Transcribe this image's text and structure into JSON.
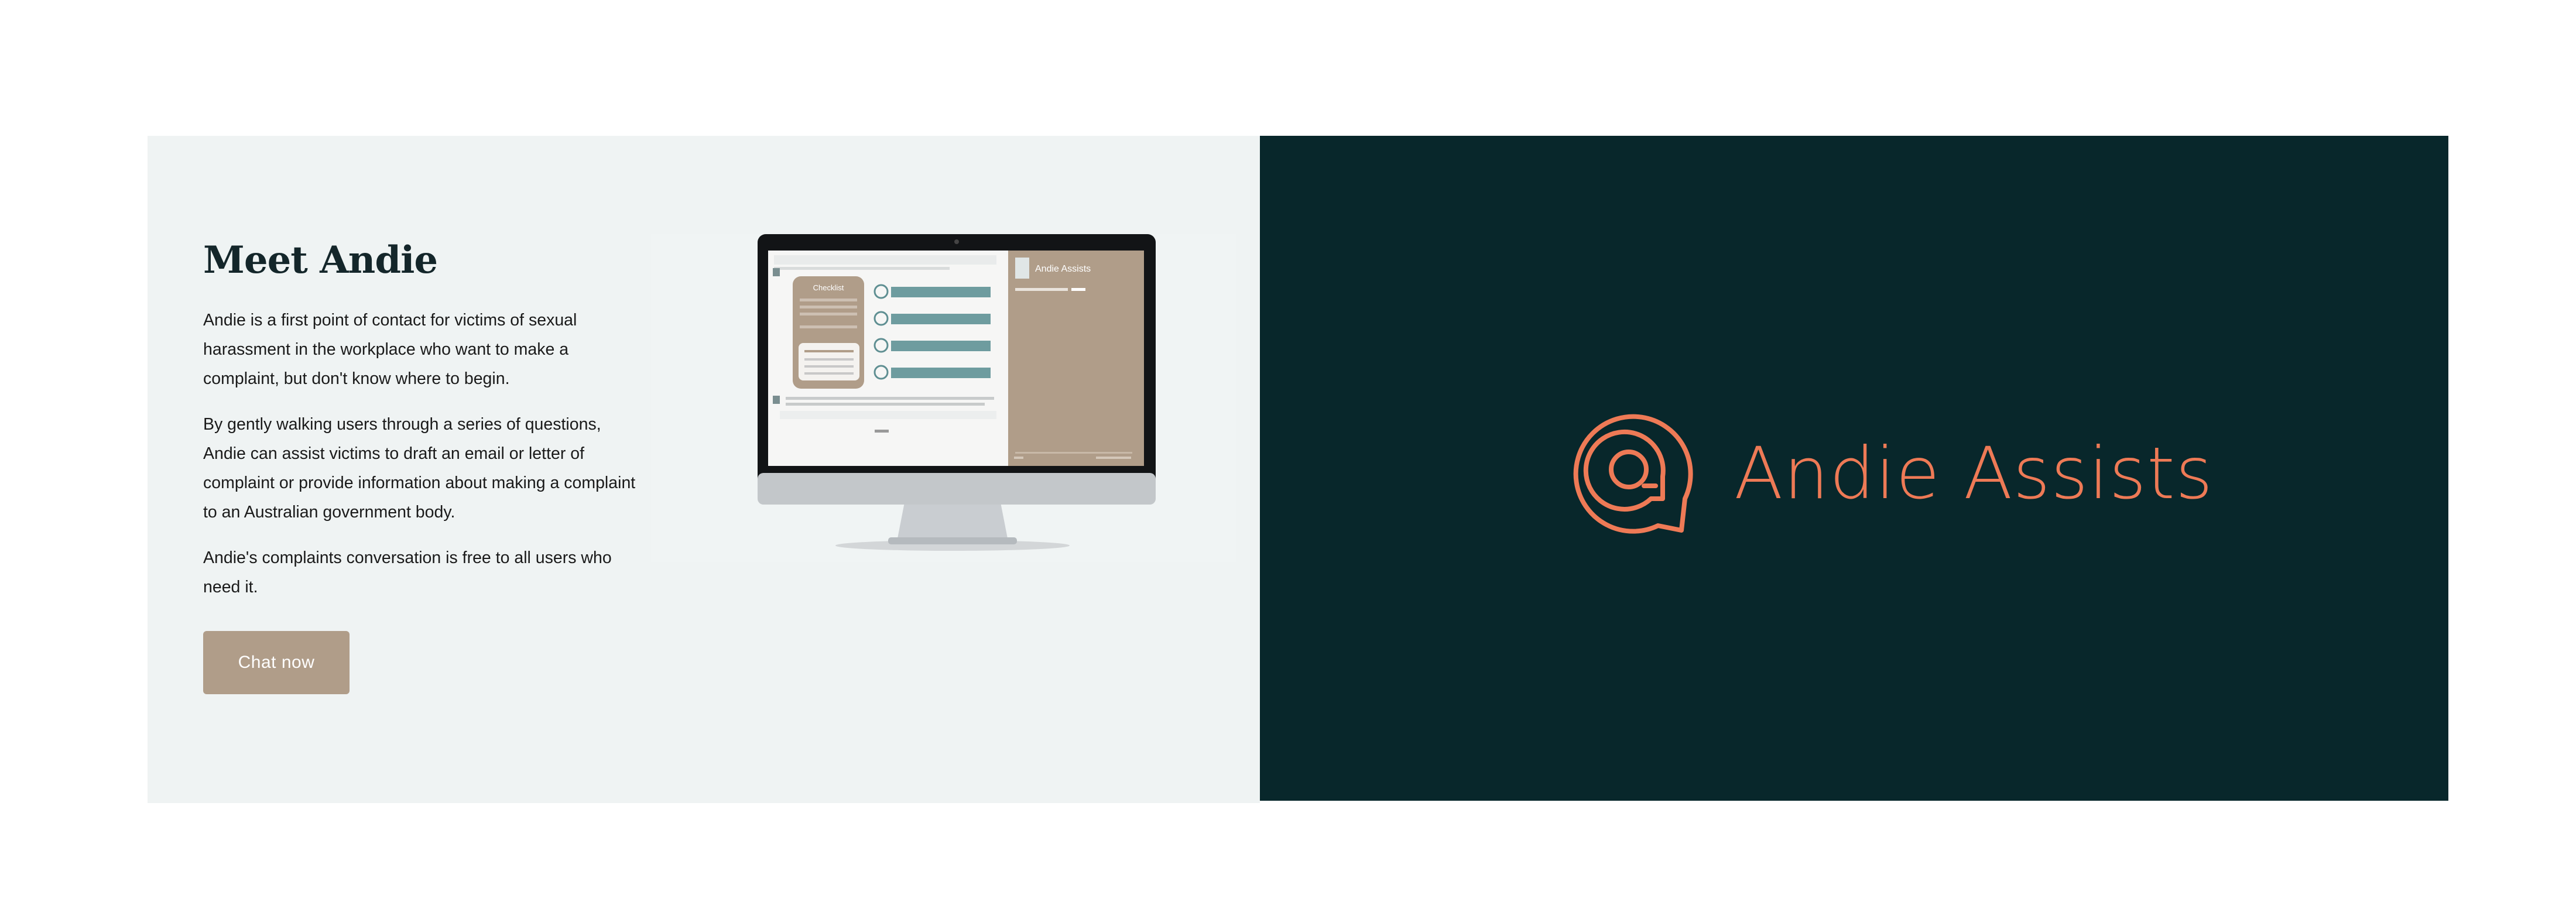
{
  "about": {
    "title": "Meet Andie",
    "paragraphs": [
      "Andie is a first point of contact for victims of sexual harassment in the workplace who want to make a complaint, but don't know where to begin.",
      "By gently walking users through a series of questions, Andie can assist victims to draft an email or letter of complaint or provide information about making a complaint to an Australian government body.",
      "Andie's complaints conversation is free to all users who need it."
    ],
    "cta_label": "Chat now"
  },
  "mockup": {
    "panel_title": "Andie Assists",
    "checklist_title": "Checklist"
  },
  "brand": {
    "name": "Andie Assists",
    "icon": "chat-bubble-at-icon",
    "accent_color": "#ee7a56"
  },
  "colors": {
    "left_background": "#eff3f3",
    "right_background": "#08272b",
    "button": "#b09d89"
  }
}
